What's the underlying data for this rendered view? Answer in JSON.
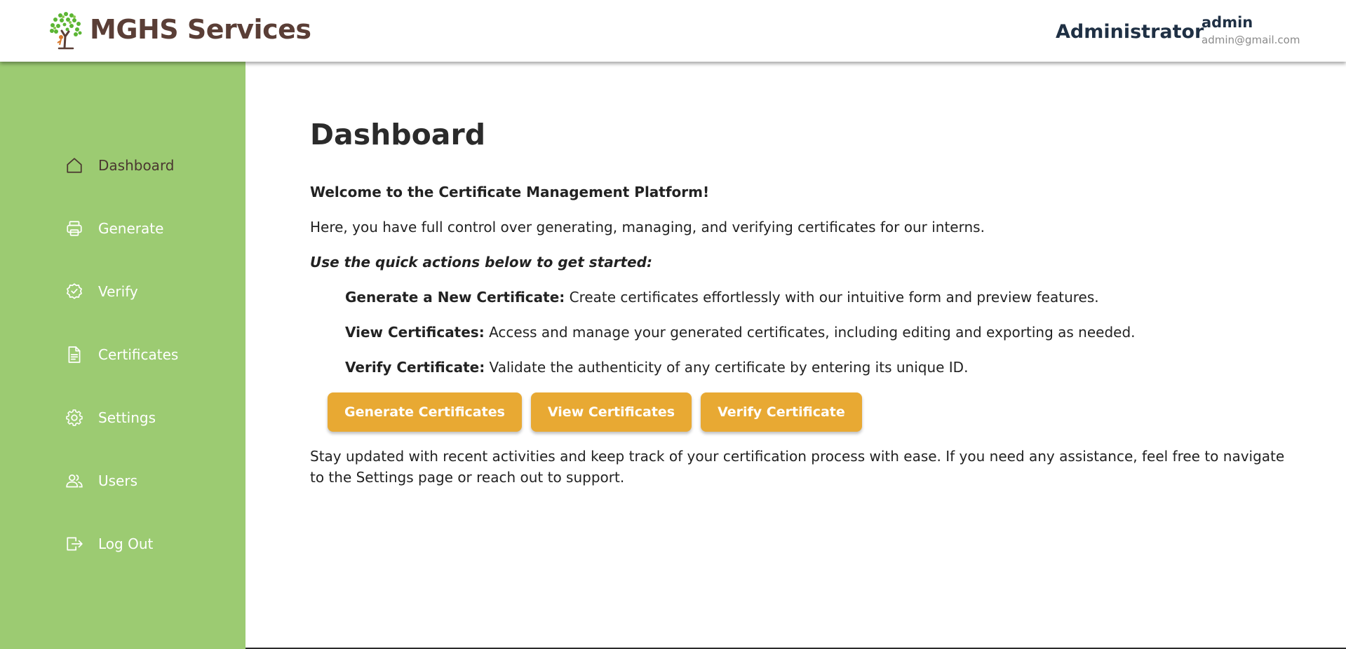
{
  "header": {
    "brand_name": "MGHS Services",
    "logo_icon": "tree-logo",
    "role": "Administrator",
    "user_name": "admin",
    "user_email": "admin@gmail.com"
  },
  "sidebar": {
    "items": [
      {
        "label": "Dashboard",
        "icon": "home-icon",
        "active": true
      },
      {
        "label": "Generate",
        "icon": "printer-icon",
        "active": false
      },
      {
        "label": "Verify",
        "icon": "badge-check-icon",
        "active": false
      },
      {
        "label": "Certificates",
        "icon": "document-icon",
        "active": false
      },
      {
        "label": "Settings",
        "icon": "gear-icon",
        "active": false
      },
      {
        "label": "Users",
        "icon": "users-icon",
        "active": false
      },
      {
        "label": "Log Out",
        "icon": "logout-icon",
        "active": false
      }
    ]
  },
  "main": {
    "title": "Dashboard",
    "welcome": "Welcome to the Certificate Management Platform!",
    "intro": "Here, you have full control over generating, managing, and verifying certificates for our interns.",
    "quick_actions_heading": "Use the quick actions below to get started:",
    "features": [
      {
        "title": "Generate a New Certificate:",
        "text": " Create certificates effortlessly with our intuitive form and preview features."
      },
      {
        "title": "View Certificates:",
        "text": " Access and manage your generated certificates, including editing and exporting as needed."
      },
      {
        "title": "Verify Certificate:",
        "text": " Validate the authenticity of any certificate by entering its unique ID."
      }
    ],
    "buttons": {
      "generate": "Generate Certificates",
      "view": "View Certificates",
      "verify": "Verify Certificate"
    },
    "outro": "Stay updated with recent activities and keep track of your certification process with ease. If you need any assistance, feel free to navigate to the Settings page or reach out to support."
  },
  "colors": {
    "sidebar_bg": "#9ccb72",
    "button_bg": "#e8a933",
    "brand_text": "#5a3e36",
    "active_nav_text": "#4a3730"
  }
}
